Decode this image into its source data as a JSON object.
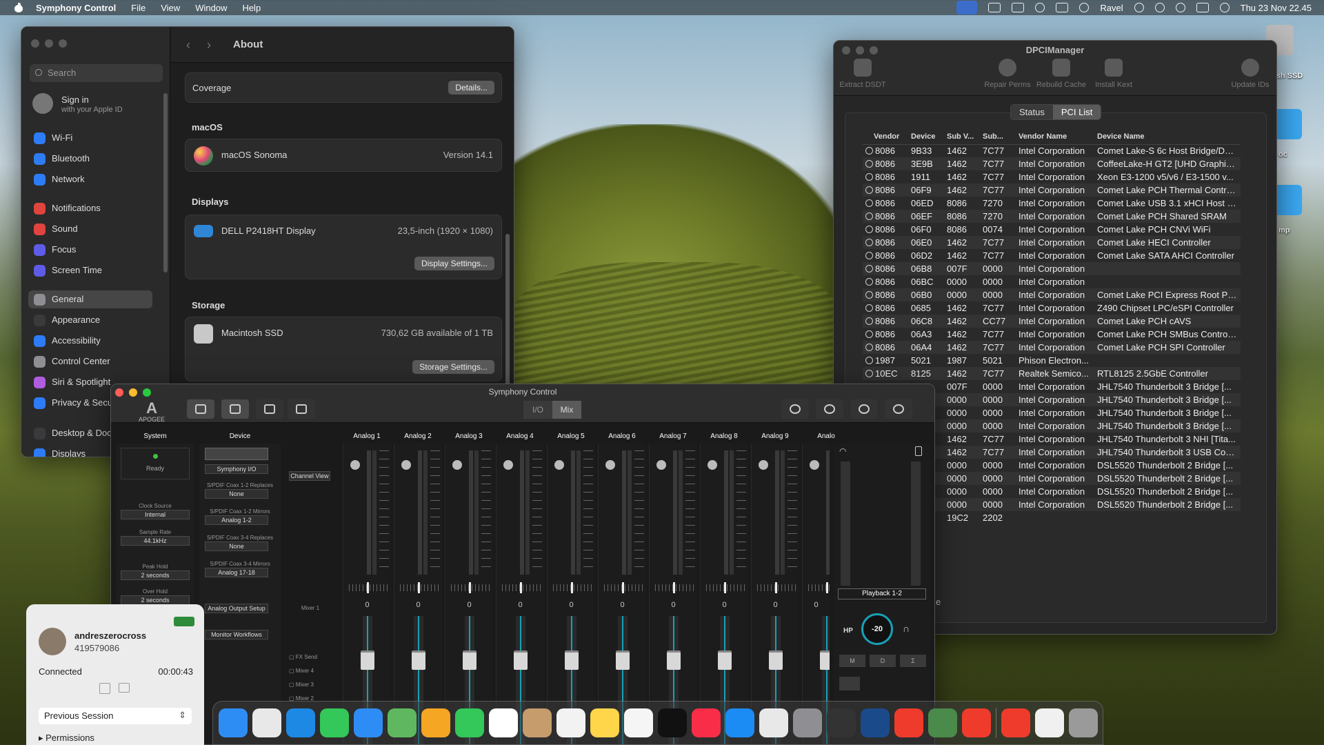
{
  "menubar": {
    "app": "Symphony Control",
    "items": [
      "File",
      "View",
      "Window",
      "Help"
    ],
    "user": "Ravel",
    "datetime": "Thu 23 Nov  22.45"
  },
  "desktop": {
    "icon1": "osh SSD",
    "icon2": "oc",
    "icon3": "mp"
  },
  "settings": {
    "search_placeholder": "Search",
    "signin_title": "Sign in",
    "signin_sub": "with your Apple ID",
    "sidebar": [
      {
        "label": "Wi-Fi",
        "color": "#2d7cf6"
      },
      {
        "label": "Bluetooth",
        "color": "#2d7cf6"
      },
      {
        "label": "Network",
        "color": "#2d7cf6"
      },
      {
        "label": "Notifications",
        "color": "#e0443e"
      },
      {
        "label": "Sound",
        "color": "#e0443e"
      },
      {
        "label": "Focus",
        "color": "#5e5ce6"
      },
      {
        "label": "Screen Time",
        "color": "#5e5ce6"
      },
      {
        "label": "General",
        "color": "#8e8e93"
      },
      {
        "label": "Appearance",
        "color": "#3a3a3c"
      },
      {
        "label": "Accessibility",
        "color": "#2d7cf6"
      },
      {
        "label": "Control Center",
        "color": "#8e8e93"
      },
      {
        "label": "Siri & Spotlight",
        "color": "#b05cdf"
      },
      {
        "label": "Privacy & Security",
        "color": "#2d7cf6"
      },
      {
        "label": "Desktop & Dock",
        "color": "#3a3a3c"
      },
      {
        "label": "Displays",
        "color": "#2d7cf6"
      }
    ],
    "title": "About",
    "coverage_label": "Coverage",
    "coverage_btn": "Details...",
    "macos_header": "macOS",
    "macos_name": "macOS Sonoma",
    "macos_version": "Version 14.1",
    "displays_header": "Displays",
    "display_name": "DELL P2418HT Display",
    "display_size": "23,5-inch (1920 × 1080)",
    "display_btn": "Display Settings...",
    "storage_header": "Storage",
    "storage_name": "Macintosh SSD",
    "storage_avail": "730,62 GB available of 1 TB",
    "storage_btn": "Storage Settings..."
  },
  "dpci": {
    "title": "DPCIManager",
    "tools": [
      "Extract DSDT",
      "Repair Perms",
      "Rebuild Cache",
      "Install Kext",
      "Update IDs"
    ],
    "tabs": [
      "Status",
      "PCI List"
    ],
    "columns": [
      "Vendor",
      "Device",
      "Sub V...",
      "Sub...",
      "Vendor Name",
      "Device Name"
    ],
    "rows": [
      [
        "8086",
        "9B33",
        "1462",
        "7C77",
        "Intel Corporation",
        "Comet Lake-S 6c Host Bridge/DR..."
      ],
      [
        "8086",
        "3E9B",
        "1462",
        "7C77",
        "Intel Corporation",
        "CoffeeLake-H GT2 [UHD Graphic..."
      ],
      [
        "8086",
        "1911",
        "1462",
        "7C77",
        "Intel Corporation",
        "Xeon E3-1200 v5/v6 / E3-1500 v..."
      ],
      [
        "8086",
        "06F9",
        "1462",
        "7C77",
        "Intel Corporation",
        "Comet Lake PCH Thermal Contro..."
      ],
      [
        "8086",
        "06ED",
        "8086",
        "7270",
        "Intel Corporation",
        "Comet Lake USB 3.1 xHCI Host C..."
      ],
      [
        "8086",
        "06EF",
        "8086",
        "7270",
        "Intel Corporation",
        "Comet Lake PCH Shared SRAM"
      ],
      [
        "8086",
        "06F0",
        "8086",
        "0074",
        "Intel Corporation",
        "Comet Lake PCH CNVi WiFi"
      ],
      [
        "8086",
        "06E0",
        "1462",
        "7C77",
        "Intel Corporation",
        "Comet Lake HECI Controller"
      ],
      [
        "8086",
        "06D2",
        "1462",
        "7C77",
        "Intel Corporation",
        "Comet Lake SATA AHCI Controller"
      ],
      [
        "8086",
        "06B8",
        "007F",
        "0000",
        "Intel Corporation",
        ""
      ],
      [
        "8086",
        "06BC",
        "0000",
        "0000",
        "Intel Corporation",
        ""
      ],
      [
        "8086",
        "06B0",
        "0000",
        "0000",
        "Intel Corporation",
        "Comet Lake PCI Express Root Por..."
      ],
      [
        "8086",
        "0685",
        "1462",
        "7C77",
        "Intel Corporation",
        "Z490 Chipset LPC/eSPI Controller"
      ],
      [
        "8086",
        "06C8",
        "1462",
        "CC77",
        "Intel Corporation",
        "Comet Lake PCH cAVS"
      ],
      [
        "8086",
        "06A3",
        "1462",
        "7C77",
        "Intel Corporation",
        "Comet Lake PCH SMBus Controller"
      ],
      [
        "8086",
        "06A4",
        "1462",
        "7C77",
        "Intel Corporation",
        "Comet Lake PCH SPI Controller"
      ],
      [
        "1987",
        "5021",
        "1987",
        "5021",
        "Phison Electron...",
        ""
      ],
      [
        "10EC",
        "8125",
        "1462",
        "7C77",
        "Realtek Semico...",
        "RTL8125 2.5GbE Controller"
      ],
      [
        "",
        "",
        "007F",
        "0000",
        "Intel Corporation",
        "JHL7540 Thunderbolt 3 Bridge [..."
      ],
      [
        "",
        "",
        "0000",
        "0000",
        "Intel Corporation",
        "JHL7540 Thunderbolt 3 Bridge [..."
      ],
      [
        "",
        "",
        "0000",
        "0000",
        "Intel Corporation",
        "JHL7540 Thunderbolt 3 Bridge [..."
      ],
      [
        "",
        "",
        "0000",
        "0000",
        "Intel Corporation",
        "JHL7540 Thunderbolt 3 Bridge [..."
      ],
      [
        "",
        "",
        "1462",
        "7C77",
        "Intel Corporation",
        "JHL7540 Thunderbolt 3 NHI [Tita..."
      ],
      [
        "",
        "",
        "1462",
        "7C77",
        "Intel Corporation",
        "JHL7540 Thunderbolt 3 USB Con..."
      ],
      [
        "",
        "",
        "0000",
        "0000",
        "Intel Corporation",
        "DSL5520 Thunderbolt 2 Bridge [..."
      ],
      [
        "",
        "",
        "0000",
        "0000",
        "Intel Corporation",
        "DSL5520 Thunderbolt 2 Bridge [..."
      ],
      [
        "",
        "",
        "0000",
        "0000",
        "Intel Corporation",
        "DSL5520 Thunderbolt 2 Bridge [..."
      ],
      [
        "",
        "",
        "0000",
        "0000",
        "Intel Corporation",
        "DSL5520 Thunderbolt 2 Bridge [..."
      ],
      [
        "",
        "",
        "19C2",
        "2202",
        "",
        ""
      ]
    ],
    "footer_fragment": "e"
  },
  "symphony": {
    "title": "Symphony Control",
    "logo": "APOGEE",
    "io": "I/O",
    "mix": "Mix",
    "system_header": "System",
    "device_header": "Device",
    "status": "Ready",
    "clock_label": "Clock Source",
    "clock_val": "Internal",
    "rate_label": "Sample Rate",
    "rate_val": "44.1kHz",
    "peak_label": "Peak Hold",
    "peak_val": "2 seconds",
    "over_label": "Over Hold",
    "over_val": "2 seconds",
    "device_name": "Symphony I/O",
    "spdif1_label": "S/PDIF Coax 1-2 Replaces",
    "spdif1_val": "None",
    "spdif2_label": "S/PDIF Coax 1-2 Mirrors",
    "spdif2_val": "Analog 1-2",
    "spdif3_label": "S/PDIF Coax 3-4 Replaces",
    "spdif3_val": "None",
    "spdif4_label": "S/PDIF Coax 3-4 Mirrors",
    "spdif4_val": "Analog 17-18",
    "aos_btn": "Analog Output Setup",
    "mw_btn": "Monitor Workflows",
    "channel_view": "Channel View",
    "mixer1": "Mixer 1",
    "sends": [
      "FX Send",
      "Mixer 4",
      "Mixer 3",
      "Mixer 2"
    ],
    "channels": [
      "Analog 1",
      "Analog 2",
      "Analog 3",
      "Analog 4",
      "Analog 5",
      "Analog 6",
      "Analog 7",
      "Analog 8",
      "Analog 9",
      "Analo"
    ],
    "fader_val": "0",
    "playback": "Playback 1-2",
    "hp": "HP",
    "hp_level": "-20",
    "mdb": [
      "M",
      "D",
      "Σ"
    ]
  },
  "call": {
    "name": "andreszerocross",
    "id": "419579086",
    "status": "Connected",
    "time": "00:00:43",
    "prev_session": "Previous Session",
    "permissions": "Permissions"
  }
}
